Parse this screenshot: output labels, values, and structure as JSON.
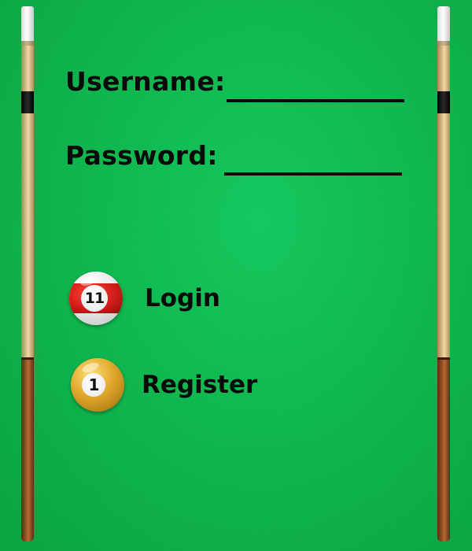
{
  "form": {
    "username_label": "Username:",
    "username_value": "",
    "password_label": "Password:",
    "password_value": ""
  },
  "buttons": {
    "login": {
      "label": "Login",
      "ball_number": "11",
      "ball_icon": "billiard-ball-11-icon",
      "ball_color": "#d61f1a"
    },
    "register": {
      "label": "Register",
      "ball_number": "1",
      "ball_icon": "billiard-ball-1-icon",
      "ball_color": "#e0a82a"
    }
  },
  "decorations": {
    "left_cue_icon": "cue-stick-icon",
    "right_cue_icon": "cue-stick-icon",
    "felt_color": "#11bd55"
  }
}
